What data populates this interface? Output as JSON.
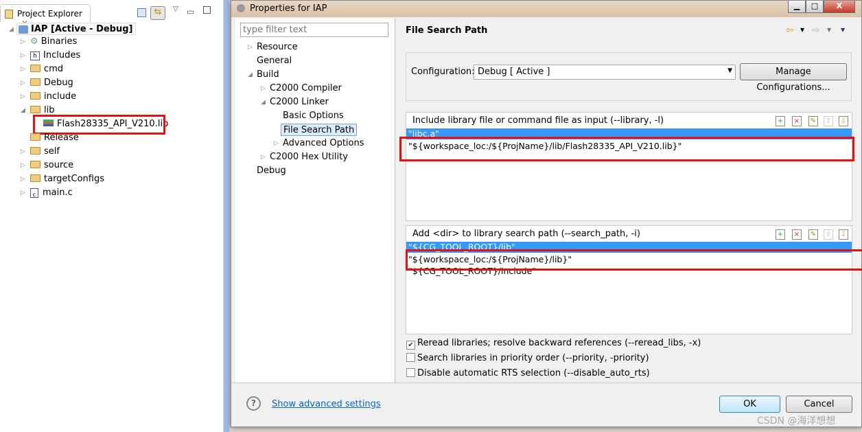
{
  "explorer": {
    "title": "Project Explorer",
    "project": "IAP  [Active - Debug]",
    "items": [
      {
        "label": "Binaries"
      },
      {
        "label": "Includes"
      },
      {
        "label": "cmd"
      },
      {
        "label": "Debug"
      },
      {
        "label": "include"
      },
      {
        "label": "lib"
      },
      {
        "label": "Flash28335_API_V210.lib"
      },
      {
        "label": "Release"
      },
      {
        "label": "self"
      },
      {
        "label": "source"
      },
      {
        "label": "targetConfigs"
      },
      {
        "label": "main.c"
      }
    ]
  },
  "dialog": {
    "title": "Properties for IAP",
    "filter_placeholder": "type filter text",
    "tree": [
      {
        "label": "Resource"
      },
      {
        "label": "General"
      },
      {
        "label": "Build"
      },
      {
        "label": "C2000 Compiler"
      },
      {
        "label": "C2000 Linker"
      },
      {
        "label": "Basic Options"
      },
      {
        "label": "File Search Path"
      },
      {
        "label": "Advanced Options"
      },
      {
        "label": "C2000 Hex Utility"
      },
      {
        "label": "Debug"
      }
    ],
    "page_title": "File Search Path",
    "configuration_label": "Configuration:",
    "configuration_value": "Debug   [ Active ]",
    "manage_button": "Manage Configurations...",
    "library_list": {
      "title": "Include library file or command file as input (--library, -l)",
      "rows": [
        "\"libc.a\"",
        "\"${workspace_loc:/${ProjName}/lib/Flash28335_API_V210.lib}\""
      ]
    },
    "search_list": {
      "title": "Add <dir> to library search path (--search_path, -i)",
      "rows": [
        "\"${CG_TOOL_ROOT}/lib\"",
        "\"${workspace_loc:/${ProjName}/lib}\"",
        "\"${CG_TOOL_ROOT}/include\""
      ]
    },
    "options": [
      {
        "label": "Reread libraries; resolve backward references (--reread_libs, -x)",
        "checked": true
      },
      {
        "label": "Search libraries in priority order (--priority, -priority)",
        "checked": false
      },
      {
        "label": "Disable automatic RTS selection (--disable_auto_rts)",
        "checked": false
      }
    ],
    "advanced_link": "Show advanced settings",
    "ok": "OK",
    "cancel": "Cancel"
  },
  "watermark": "CSDN @海洋想想",
  "colors": {
    "selection": "#3399ff",
    "highlight_box": "#e51010",
    "link": "#0066cc"
  }
}
